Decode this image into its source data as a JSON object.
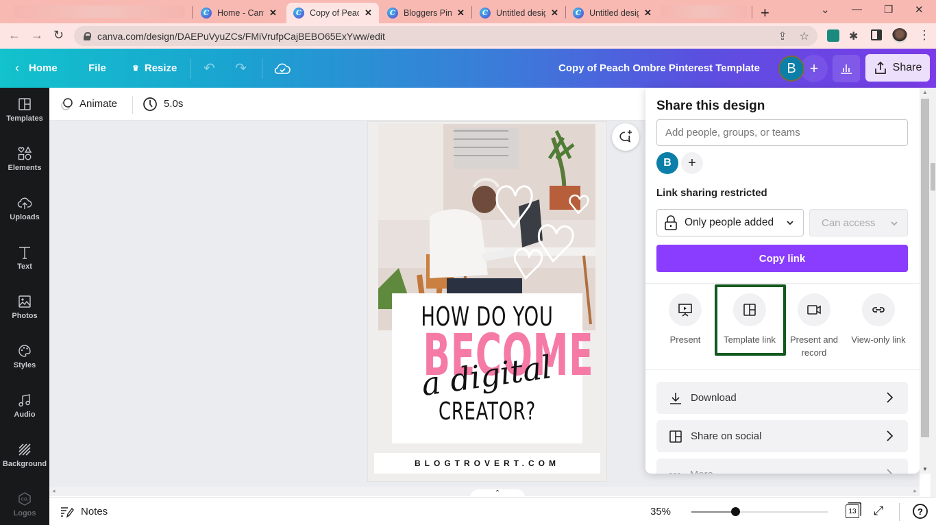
{
  "browser": {
    "tabs": [
      {
        "title": "Home - Canva",
        "active": false
      },
      {
        "title": "Copy of Peach",
        "active": true
      },
      {
        "title": "Bloggers Pint",
        "active": false
      },
      {
        "title": "Untitled desig",
        "active": false
      },
      {
        "title": "Untitled desig",
        "active": false
      }
    ],
    "favicon_letter": "C",
    "url": "canva.com/design/DAEPuVyuZCs/FMiVrufpCajBEBO65ExYww/edit",
    "new_tab_label": "+",
    "minimize": "—",
    "restore": "❐",
    "close": "✕",
    "tab_list": "⌄"
  },
  "header": {
    "home_label": "Home",
    "file_label": "File",
    "resize_label": "Resize",
    "document_title": "Copy of Peach Ombre Pinterest Template",
    "avatar_initial": "B",
    "share_label": "Share",
    "colors": {
      "gradient_start": "#12c2cc",
      "gradient_end": "#7b3be8"
    }
  },
  "sidebar": {
    "items": [
      {
        "label": "Templates",
        "icon": "templates-icon"
      },
      {
        "label": "Elements",
        "icon": "elements-icon"
      },
      {
        "label": "Uploads",
        "icon": "uploads-icon"
      },
      {
        "label": "Text",
        "icon": "text-icon"
      },
      {
        "label": "Photos",
        "icon": "photos-icon"
      },
      {
        "label": "Styles",
        "icon": "styles-icon"
      },
      {
        "label": "Audio",
        "icon": "audio-icon"
      },
      {
        "label": "Background",
        "icon": "background-icon"
      },
      {
        "label": "Logos",
        "icon": "logos-icon"
      }
    ]
  },
  "toolbar": {
    "animate_label": "Animate",
    "duration": "5.0s"
  },
  "design": {
    "line1": "HOW DO YOU",
    "line2": "BECOME",
    "line3": "a digital",
    "line4": "CREATOR?",
    "website": "BLOGTROVERT.COM",
    "accent_color": "#f57aa5"
  },
  "bottom": {
    "notes_label": "Notes",
    "zoom_percent": "35%",
    "zoom_slider_fraction": 0.32,
    "page_count": "13",
    "help_label": "?"
  },
  "share_panel": {
    "title": "Share this design",
    "input_placeholder": "Add people, groups, or teams",
    "avatar_initial": "B",
    "link_sharing_label": "Link sharing restricted",
    "access_select": "Only people added",
    "permission_select": "Can access",
    "copy_link_label": "Copy link",
    "copy_link_color": "#8b3dff",
    "actions": [
      {
        "label": "Present",
        "icon": "present-icon"
      },
      {
        "label": "Template link",
        "icon": "template-link-icon",
        "highlighted": true
      },
      {
        "label": "Present and record",
        "icon": "present-record-icon"
      },
      {
        "label": "View-only link",
        "icon": "view-only-link-icon"
      }
    ],
    "rows": [
      {
        "label": "Download",
        "icon": "download-icon"
      },
      {
        "label": "Share on social",
        "icon": "share-social-icon"
      },
      {
        "label": "More",
        "icon": "more-icon"
      }
    ],
    "highlight_color": "#145a1e"
  }
}
